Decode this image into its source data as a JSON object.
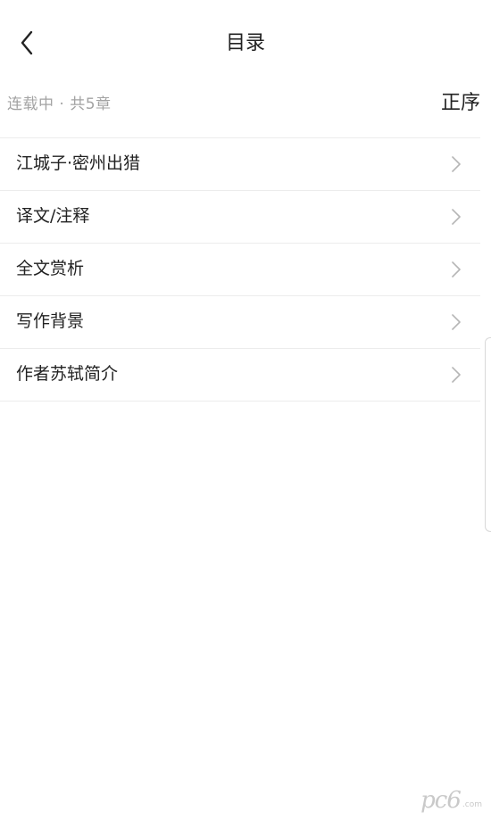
{
  "header": {
    "title": "目录"
  },
  "meta": {
    "status": "连载中 · 共5章",
    "sort_label": "正序"
  },
  "chapters": [
    {
      "label": "江城子·密州出猎"
    },
    {
      "label": "译文/注释"
    },
    {
      "label": "全文赏析"
    },
    {
      "label": "写作背景"
    },
    {
      "label": "作者苏轼简介"
    }
  ],
  "watermark": {
    "text": "pc6",
    "sub": ".com"
  },
  "icons": {
    "back": "chevron-left-icon",
    "row_arrow": "chevron-right-icon"
  },
  "colors": {
    "text": "#222222",
    "muted": "#a3a3a3",
    "divider": "#ececec",
    "chevron": "#b5b5b5"
  }
}
